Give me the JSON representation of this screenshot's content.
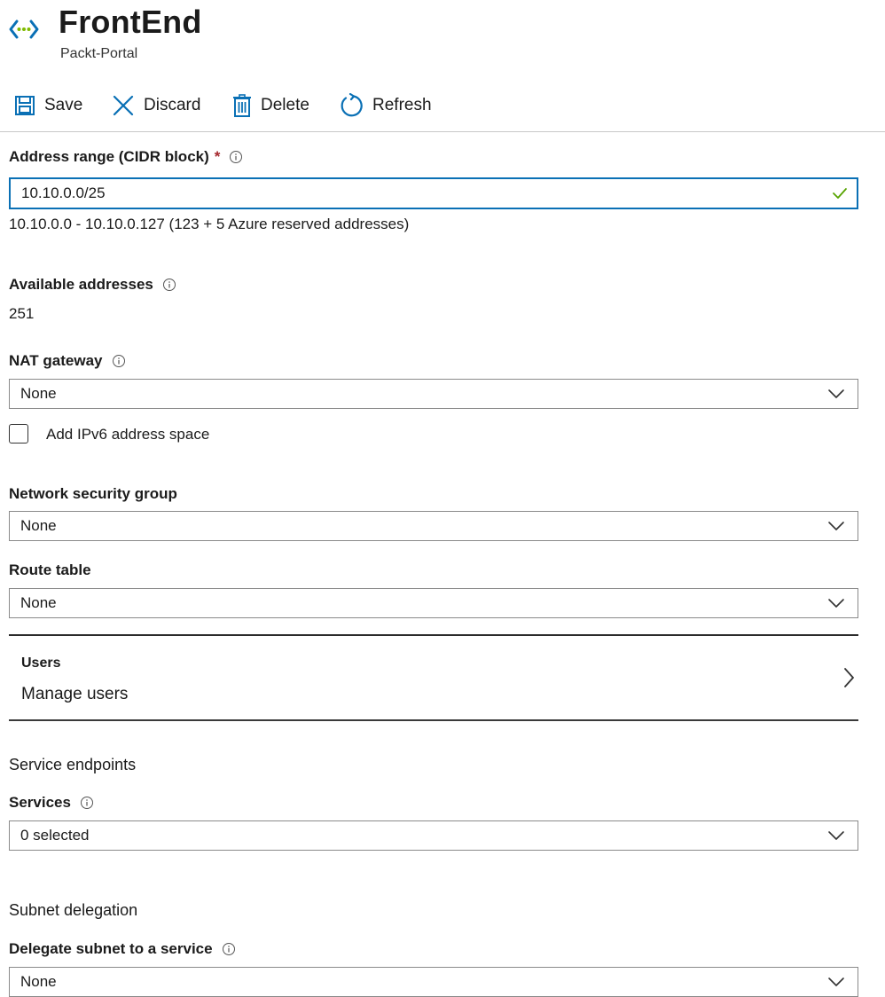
{
  "header": {
    "title": "FrontEnd",
    "subtitle": "Packt-Portal",
    "icon": "virtual-network-icon"
  },
  "toolbar": {
    "save_label": "Save",
    "discard_label": "Discard",
    "delete_label": "Delete",
    "refresh_label": "Refresh"
  },
  "address_range": {
    "label": "Address range (CIDR block)",
    "required_mark": "*",
    "value": "10.10.0.0/25",
    "hint": "10.10.0.0 - 10.10.0.127 (123 + 5 Azure reserved addresses)"
  },
  "available_addresses": {
    "label": "Available addresses",
    "value": "251"
  },
  "nat_gateway": {
    "label": "NAT gateway",
    "selected": "None"
  },
  "ipv6": {
    "label": "Add IPv6 address space",
    "checked": false
  },
  "nsg": {
    "label": "Network security group",
    "selected": "None"
  },
  "route_table": {
    "label": "Route table",
    "selected": "None"
  },
  "users": {
    "title": "Users",
    "subtitle": "Manage users"
  },
  "service_endpoints": {
    "section_title": "Service endpoints",
    "label": "Services",
    "selected": "0 selected"
  },
  "subnet_delegation": {
    "section_title": "Subnet delegation",
    "label": "Delegate subnet to a service",
    "selected": "None"
  },
  "colors": {
    "accent_blue": "#0a70b5",
    "valid_green": "#57a300",
    "required_red": "#a4262c",
    "vnet_green": "#7fba00",
    "vnet_blue": "#0a70b5"
  }
}
